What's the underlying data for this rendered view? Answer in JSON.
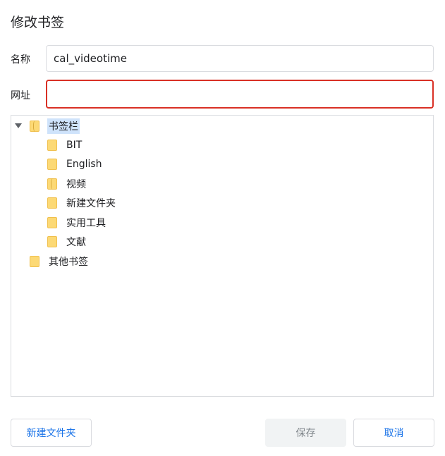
{
  "dialog": {
    "title": "修改书签"
  },
  "form": {
    "name_label": "名称",
    "name_value": "cal_videotime",
    "url_label": "网址",
    "url_value": ""
  },
  "tree": {
    "root": {
      "label": "书签栏",
      "expanded": true,
      "selected": true
    },
    "children": [
      {
        "label": "BIT"
      },
      {
        "label": "English"
      },
      {
        "label": "视频"
      },
      {
        "label": "新建文件夹"
      },
      {
        "label": "实用工具"
      },
      {
        "label": "文献"
      }
    ],
    "other": {
      "label": "其他书签"
    }
  },
  "buttons": {
    "new_folder": "新建文件夹",
    "save": "保存",
    "cancel": "取消"
  },
  "colors": {
    "accent": "#1a73e8",
    "error": "#d93025",
    "selection": "#cfe3fb",
    "folder": "#fcd975"
  }
}
